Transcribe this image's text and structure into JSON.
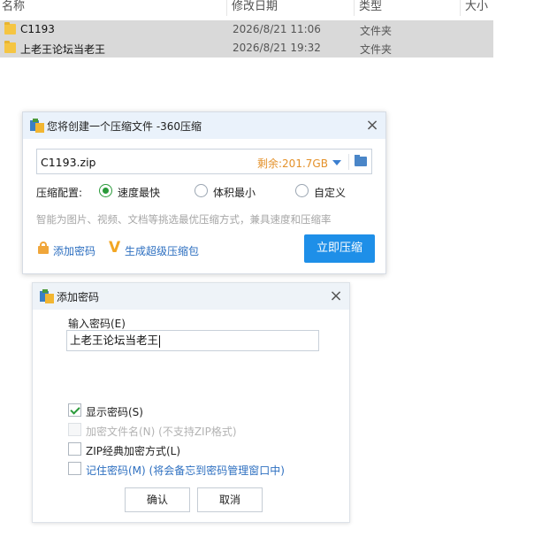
{
  "explorer": {
    "columns": [
      "名称",
      "修改日期",
      "类型",
      "大小"
    ],
    "rows": [
      {
        "name": "C1193",
        "date": "2026/8/21 11:06",
        "type": "文件夹"
      },
      {
        "name": "上老王论坛当老王",
        "date": "2026/8/21 19:32",
        "type": "文件夹"
      }
    ]
  },
  "compress_dialog": {
    "title": "您将创建一个压缩文件 -360压缩",
    "file_path": "C1193.zip",
    "remaining": "剩余:201.7GB",
    "config_label": "压缩配置:",
    "options": [
      {
        "label": "速度最快",
        "selected": true
      },
      {
        "label": "体积最小",
        "selected": false
      },
      {
        "label": "自定义",
        "selected": false
      }
    ],
    "hint": "智能为图片、视频、文档等挑选最优压缩方式，兼具速度和压缩率",
    "add_password_link": "添加密码",
    "super_pack_link": "生成超级压缩包",
    "compress_button": "立即压缩"
  },
  "password_dialog": {
    "title": "添加密码",
    "input_label": "输入密码(E)",
    "password_value": "上老王论坛当老王",
    "checkboxes": [
      {
        "label": "显示密码(S)",
        "checked": true,
        "disabled": false
      },
      {
        "label": "加密文件名(N) (不支持ZIP格式)",
        "checked": false,
        "disabled": true
      },
      {
        "label": "ZIP经典加密方式(L)",
        "checked": false,
        "disabled": false
      },
      {
        "label": "记住密码(M) (将会备忘到密码管理窗口中)",
        "checked": false,
        "disabled": false
      }
    ],
    "ok_button": "确认",
    "cancel_button": "取消"
  },
  "colors": {
    "accent": "#1e8fe8",
    "remaining": "#e4912a",
    "check": "#2a9a3a",
    "link": "#2d6fc0"
  }
}
